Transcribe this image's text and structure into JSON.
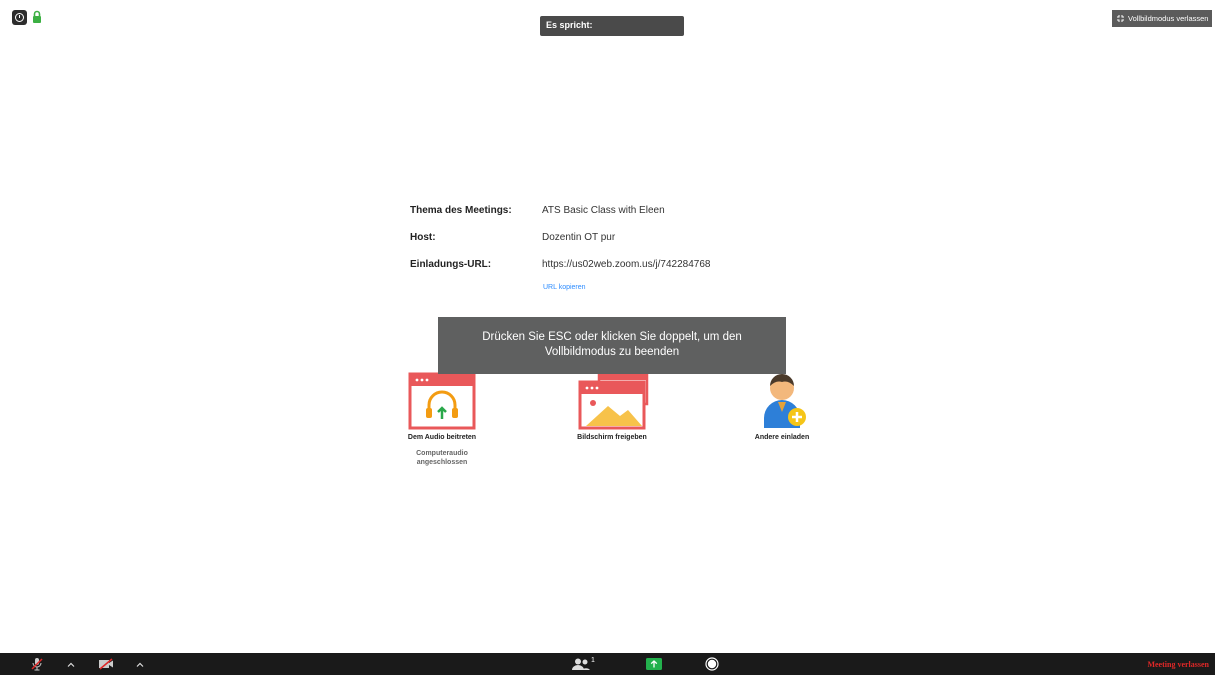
{
  "topbar": {
    "speaking_label": "Es spricht:",
    "exit_fullscreen_label": "Vollbildmodus verlassen"
  },
  "meeting": {
    "topic_label": "Thema des Meetings:",
    "topic_value": "ATS Basic Class with Eleen",
    "host_label": "Host:",
    "host_value": "Dozentin OT pur",
    "url_label": "Einladungs-URL:",
    "url_value": "https://us02web.zoom.us/j/742284768",
    "copy_url_label": "URL kopieren"
  },
  "toast": {
    "line1": "Drücken Sie ESC oder klicken Sie doppelt, um den",
    "line2": "Vollbildmodus zu beenden"
  },
  "actions": {
    "audio_title": "Dem Audio beitreten",
    "audio_sub1": "Computeraudio",
    "audio_sub2": "angeschlossen",
    "share_title": "Bildschirm freigeben",
    "invite_title": "Andere einladen"
  },
  "toolbar": {
    "participants_count": "1",
    "leave_label": "Meeting verlassen"
  },
  "colors": {
    "accent": "#2d8cff",
    "danger": "#e02828",
    "share_green": "#23b14d",
    "icon_red": "#e9585a",
    "toolbar_bg": "#1a1a1a"
  }
}
